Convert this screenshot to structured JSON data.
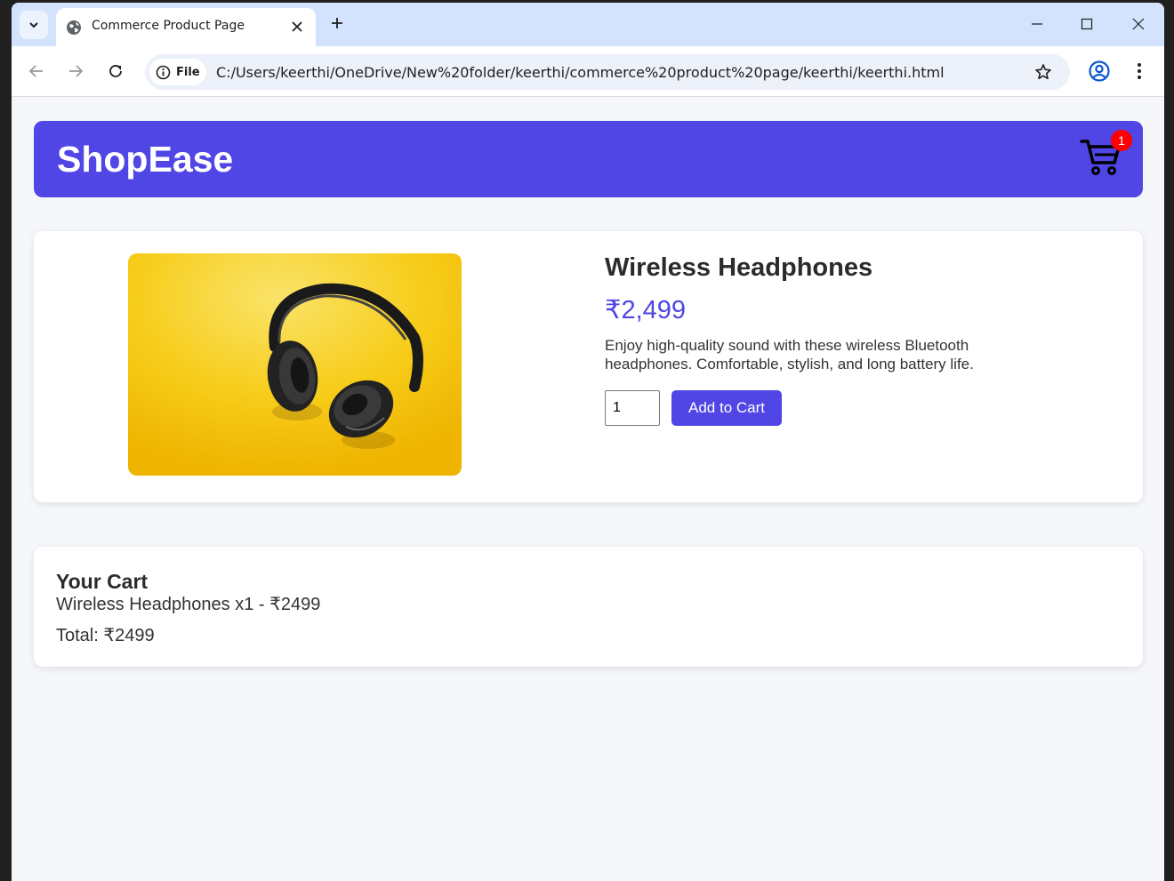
{
  "browser": {
    "tab": {
      "title": "Commerce Product Page"
    },
    "address": {
      "chip_label": "File",
      "url": "C:/Users/keerthi/OneDrive/New%20folder/keerthi/commerce%20product%20page/keerthi/keerthi.html"
    }
  },
  "header": {
    "brand": "ShopEase",
    "cart_count": "1"
  },
  "product": {
    "name": "Wireless Headphones",
    "price": "₹2,499",
    "description": "Enjoy high-quality sound with these wireless Bluetooth headphones. Comfortable, stylish, and long battery life.",
    "quantity": "1",
    "add_button": "Add to Cart"
  },
  "cart": {
    "title": "Your Cart",
    "item": "Wireless Headphones x1 - ₹2499",
    "total": "Total: ₹2499"
  },
  "colors": {
    "accent": "#4f46e5",
    "badge": "#ff0000",
    "image_bg": "#f7c600"
  }
}
